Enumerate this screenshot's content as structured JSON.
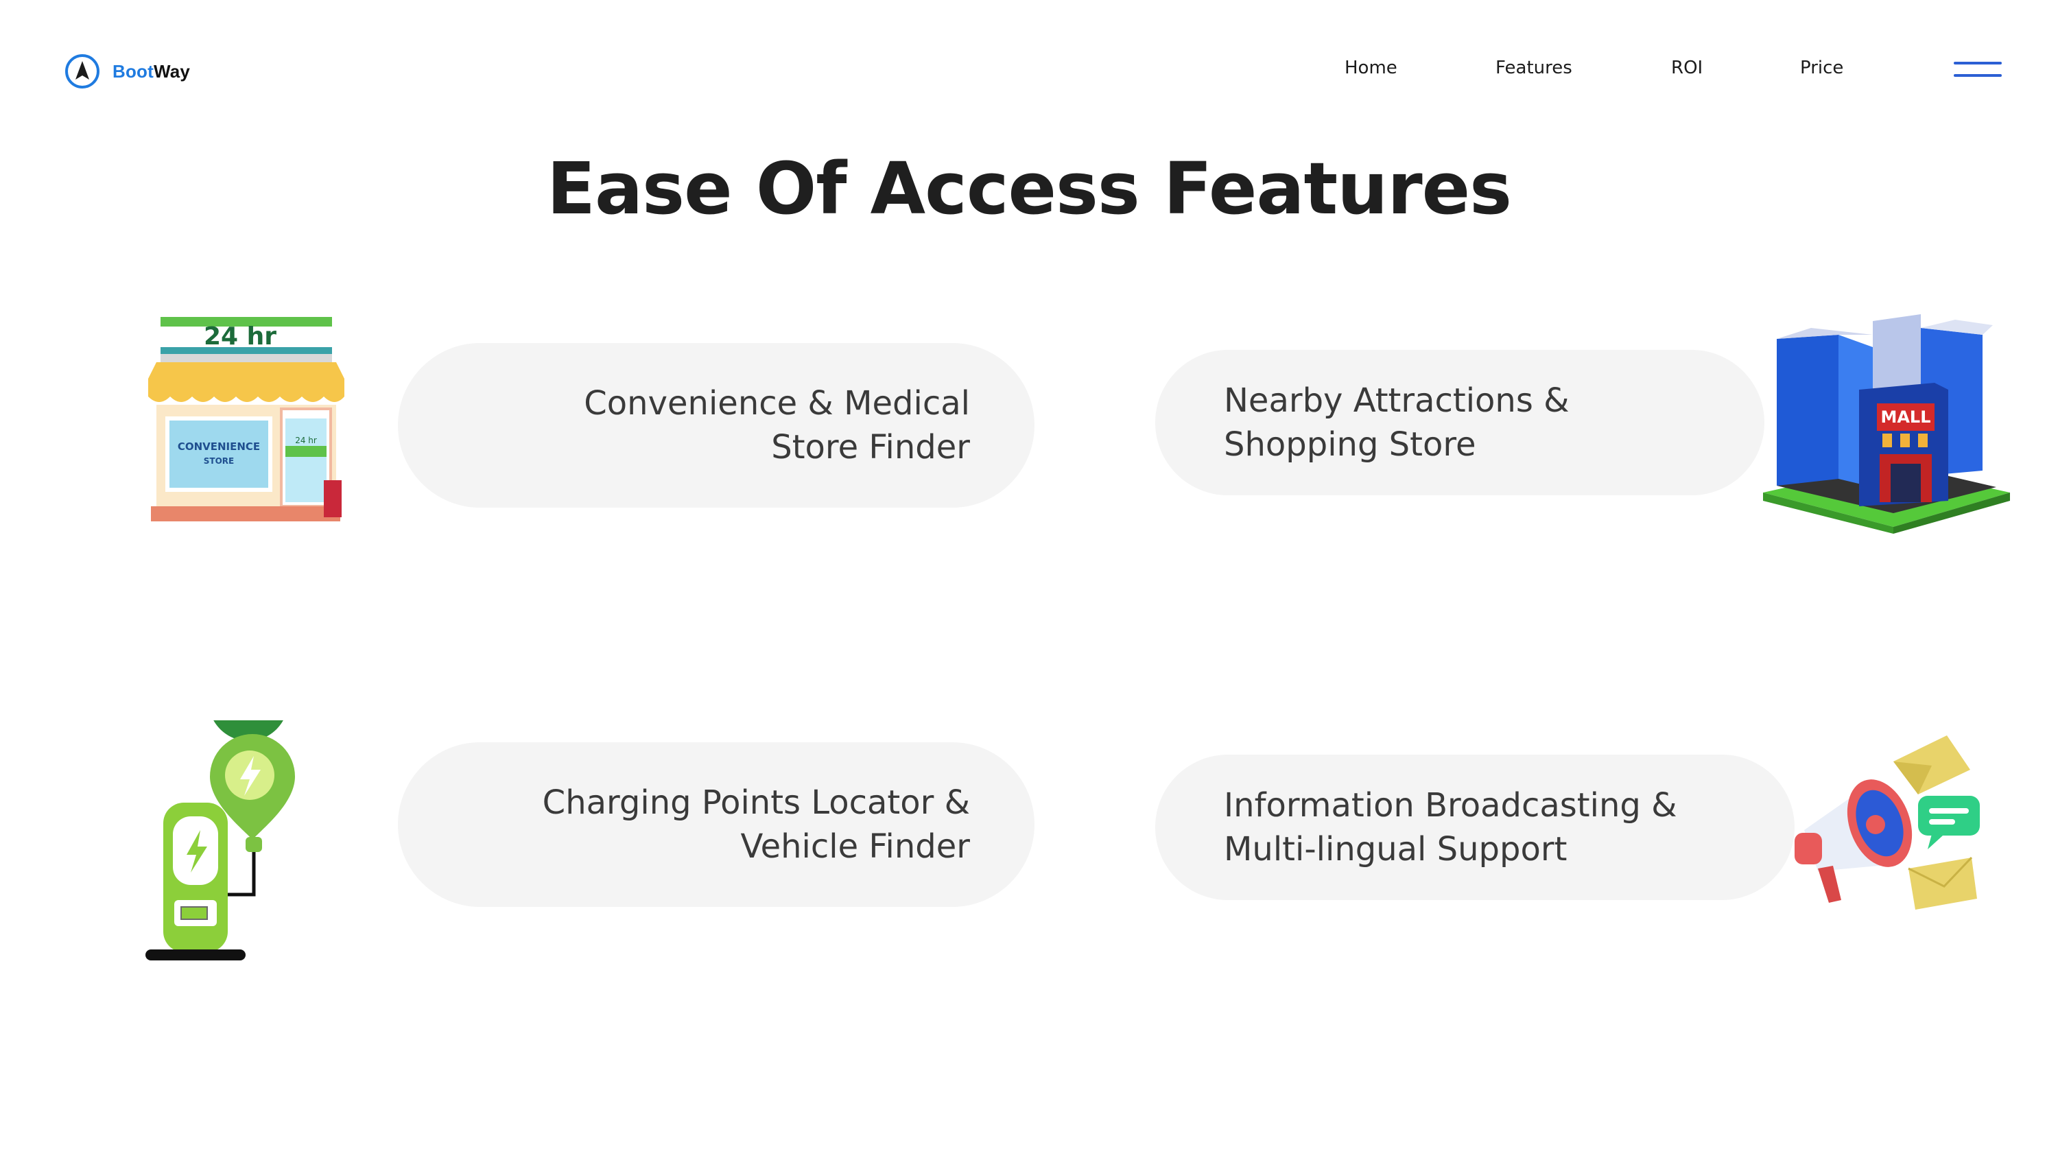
{
  "brand": {
    "name_part1": "Boot",
    "name_part2": "Way",
    "accent": "#1f7be0"
  },
  "nav": {
    "items": [
      {
        "label": "Home"
      },
      {
        "label": "Features"
      },
      {
        "label": "ROI"
      },
      {
        "label": "Price"
      }
    ],
    "menu_icon": "hamburger-icon"
  },
  "page_title": "Ease Of Access Features",
  "features": [
    {
      "label": "Convenience & Medical\nStore Finder",
      "icon": "convenience-store-icon",
      "store_sign": "24 hr",
      "store_name": "CONVENIENCE",
      "store_sub": "STORE",
      "door_sign": "24 hr"
    },
    {
      "label": "Nearby Attractions &\nShopping Store",
      "icon": "mall-building-icon",
      "mall_sign": "MALL"
    },
    {
      "label": "Charging Points Locator &\nVehicle Finder",
      "icon": "ev-charger-icon"
    },
    {
      "label": "Information Broadcasting &\nMulti-lingual Support",
      "icon": "megaphone-icon"
    }
  ]
}
